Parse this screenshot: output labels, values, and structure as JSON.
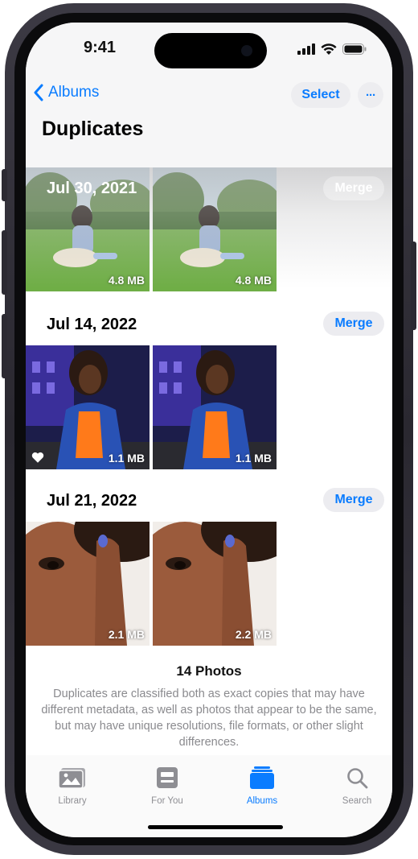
{
  "status_bar": {
    "time": "9:41"
  },
  "nav": {
    "back_label": "Albums",
    "select_label": "Select",
    "more_label": "···",
    "title": "Duplicates"
  },
  "groups": [
    {
      "date": "Jul 30, 2021",
      "merge_label": "Merge",
      "photos": [
        {
          "size": "4.8 MB"
        },
        {
          "size": "4.8 MB"
        }
      ]
    },
    {
      "date": "Jul 14, 2022",
      "merge_label": "Merge",
      "photos": [
        {
          "size": "1.1 MB",
          "favorite": true
        },
        {
          "size": "1.1 MB"
        }
      ]
    },
    {
      "date": "Jul 21, 2022",
      "merge_label": "Merge",
      "photos": [
        {
          "size": "2.1 MB"
        },
        {
          "size": "2.2 MB"
        }
      ]
    }
  ],
  "summary": {
    "count": "14 Photos",
    "description": "Duplicates are classified both as exact copies that may have different metadata, as well as photos that appear to be the same, but may have unique resolutions, file formats, or other slight differences."
  },
  "tab_bar": {
    "tabs": [
      {
        "label": "Library",
        "icon": "library-icon",
        "active": false
      },
      {
        "label": "For You",
        "icon": "for-you-icon",
        "active": false
      },
      {
        "label": "Albums",
        "icon": "albums-icon",
        "active": true
      },
      {
        "label": "Search",
        "icon": "search-icon",
        "active": false
      }
    ]
  },
  "colors": {
    "accent": "#0a7cff",
    "inactive": "#8e8e93"
  }
}
